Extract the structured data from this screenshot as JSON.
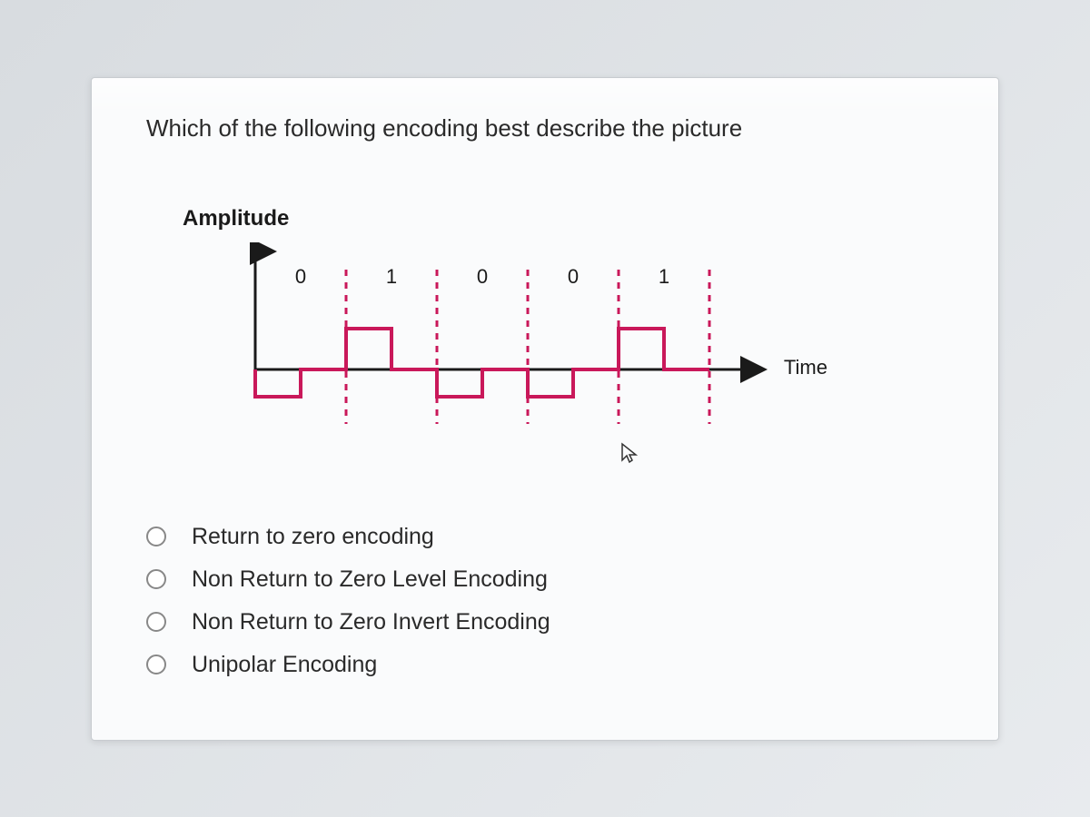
{
  "question": "Which of the following encoding best describe the picture",
  "chart_data": {
    "type": "line",
    "title": "",
    "xlabel": "Time",
    "ylabel": "Amplitude",
    "bits": [
      "0",
      "1",
      "0",
      "0",
      "1"
    ],
    "description": "Signal encoding waveform with bit intervals marked by dashed vertical lines. Signal returns to zero mid-bit.",
    "waveform_color": "#c9185a"
  },
  "diagram": {
    "ylabel": "Amplitude",
    "xlabel": "Time",
    "bit0": "0",
    "bit1": "1",
    "bit2": "0",
    "bit3": "0",
    "bit4": "1"
  },
  "options": {
    "opt0": "Return to zero encoding",
    "opt1": "Non Return to Zero Level Encoding",
    "opt2": "Non Return to Zero Invert Encoding",
    "opt3": "Unipolar Encoding"
  }
}
